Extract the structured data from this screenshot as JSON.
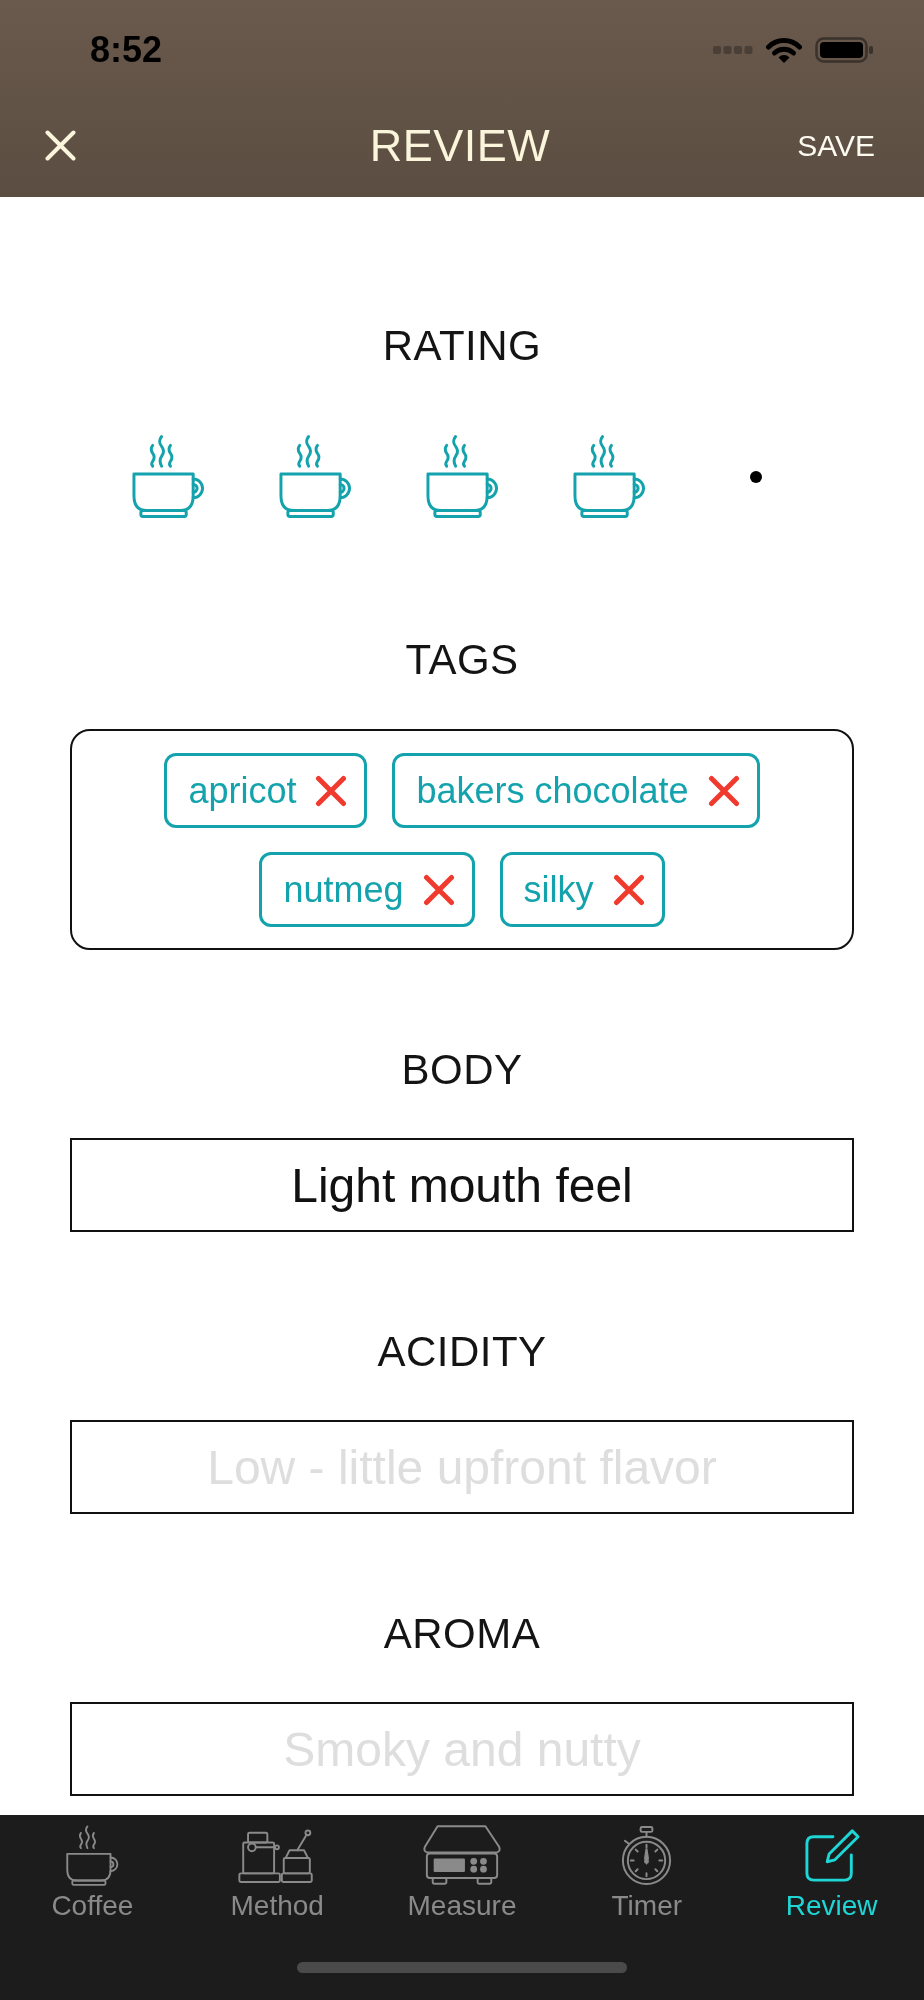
{
  "status_bar": {
    "time": "8:52"
  },
  "nav_bar": {
    "title": "REVIEW",
    "save_button": "SAVE"
  },
  "rating": {
    "label": "RATING",
    "cups": [
      {
        "filled": true
      },
      {
        "filled": true
      },
      {
        "filled": true
      },
      {
        "filled": true
      },
      {
        "filled": false
      }
    ]
  },
  "tags": {
    "label": "TAGS",
    "items": [
      "apricot",
      "bakers chocolate",
      "nutmeg",
      "silky"
    ]
  },
  "fields": [
    {
      "label": "BODY",
      "value": "Light mouth feel"
    },
    {
      "label": "ACIDITY",
      "placeholder": "Low - little upfront flavor"
    },
    {
      "label": "AROMA",
      "placeholder": "Smoky and nutty"
    }
  ],
  "tab_bar": [
    {
      "label": "Coffee",
      "selected": false
    },
    {
      "label": "Method",
      "selected": false
    },
    {
      "label": "Measure",
      "selected": false
    },
    {
      "label": "Timer",
      "selected": false
    },
    {
      "label": "Review",
      "selected": true
    }
  ]
}
